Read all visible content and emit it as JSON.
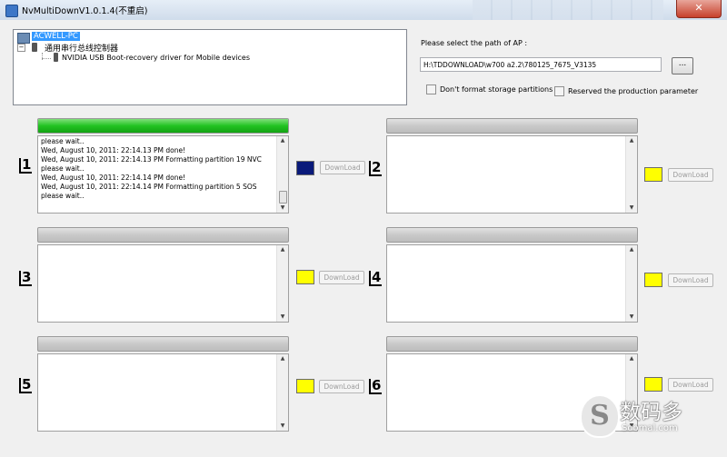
{
  "window": {
    "title": "NvMultiDownV1.0.1.4(不重启)",
    "close_glyph": "✕"
  },
  "device_tree": {
    "root_label": "ACWELL-PC",
    "controller_label": "通用串行总线控制器",
    "controller_expander": "−",
    "device_label": "NVIDIA USB Boot-recovery driver for Mobile devices"
  },
  "ap_path": {
    "label": "Please select the path of AP :",
    "value": "H:\\TDDOWNLOAD\\w700 a2.2\\780125_7675_V3135",
    "browse_label": "..."
  },
  "options": {
    "dont_format": {
      "label": "Don't format storage partitions",
      "checked": false
    },
    "reserved_param": {
      "label": "Reserved the production parameter",
      "checked": false
    }
  },
  "slots": [
    {
      "number": "1",
      "progress": 1.0,
      "status_color": "#0a1a7a",
      "download_label": "DownLoad",
      "log": [
        "please wait..",
        "Wed, August 10, 2011:  22:14.13 PM  done!",
        "Wed, August 10, 2011:  22:14.13 PM  Formatting partition 19 NVC",
        "please wait..",
        "Wed, August 10, 2011:  22:14.14 PM  done!",
        "Wed, August 10, 2011:  22:14.14 PM  Formatting partition 5 SOS",
        "please wait.."
      ]
    },
    {
      "number": "2",
      "progress": 0,
      "status_color": "#ffff00",
      "download_label": "DownLoad",
      "log": []
    },
    {
      "number": "3",
      "progress": 0,
      "status_color": "#ffff00",
      "download_label": "DownLoad",
      "log": []
    },
    {
      "number": "4",
      "progress": 0,
      "status_color": "#ffff00",
      "download_label": "DownLoad",
      "log": []
    },
    {
      "number": "5",
      "progress": 0,
      "status_color": "#ffff00",
      "download_label": "DownLoad",
      "log": []
    },
    {
      "number": "6",
      "progress": 0,
      "status_color": "#ffff00",
      "download_label": "DownLoad",
      "log": []
    }
  ],
  "scrollbar": {
    "up_glyph": "▲",
    "down_glyph": "▼"
  },
  "watermark": {
    "logo_glyph": "S",
    "cn_text": "数码多",
    "en_text": "Soomal.com"
  }
}
